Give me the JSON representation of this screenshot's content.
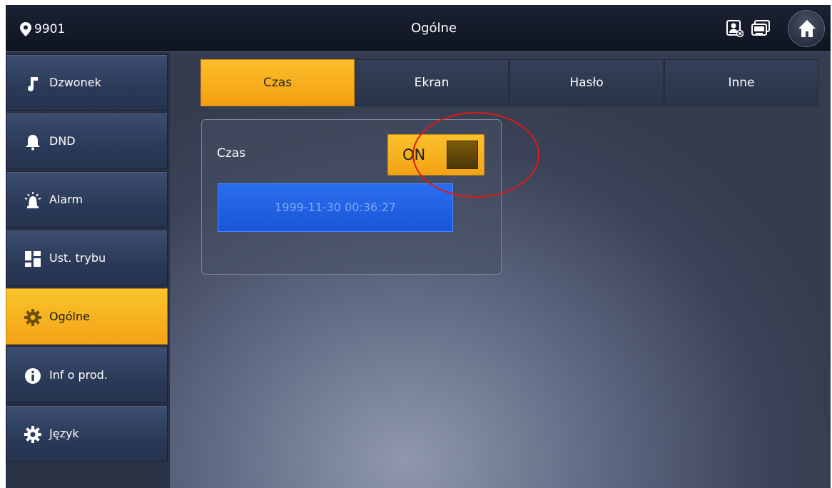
{
  "topbar": {
    "room_number": "9901",
    "title": "Ogólne",
    "icons": [
      "location-pin-icon",
      "contact-card-icon",
      "monitor-icon",
      "home-icon"
    ]
  },
  "sidebar": {
    "items": [
      {
        "label": "Dzwonek",
        "icon": "music-note-icon",
        "active": false
      },
      {
        "label": "DND",
        "icon": "bell-icon",
        "active": false
      },
      {
        "label": "Alarm",
        "icon": "siren-icon",
        "active": false
      },
      {
        "label": "Ust. trybu",
        "icon": "grid-icon",
        "active": false
      },
      {
        "label": "Ogólne",
        "icon": "gear-icon",
        "active": true
      },
      {
        "label": "Inf o prod.",
        "icon": "info-icon",
        "active": false
      },
      {
        "label": "Język",
        "icon": "gear-icon",
        "active": false
      }
    ]
  },
  "tabs": [
    {
      "label": "Czas",
      "active": true
    },
    {
      "label": "Ekran",
      "active": false
    },
    {
      "label": "Hasło",
      "active": false
    },
    {
      "label": "Inne",
      "active": false
    }
  ],
  "time_panel": {
    "label": "Czas",
    "toggle_text": "ON",
    "toggle_state": "on",
    "datetime": "1999-11-30 00:36:27"
  },
  "colors": {
    "accent": "#f5a51a",
    "highlight_ring": "#e01818",
    "datetime_field": "#1f5fe0"
  }
}
